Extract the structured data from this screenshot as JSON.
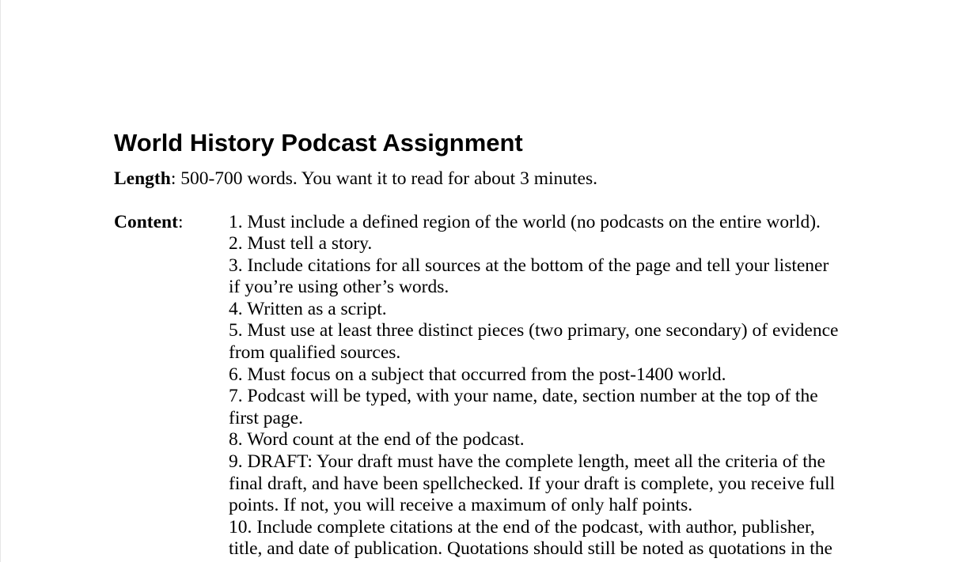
{
  "document": {
    "title": "World History Podcast Assignment",
    "length": {
      "label": "Length",
      "separator": ":",
      "text": " 500-700 words.  You want it to read for about 3 minutes."
    },
    "content": {
      "label": "Content",
      "separator": ":",
      "items": [
        "1. Must include a defined region of the world (no podcasts on the entire world).",
        "2. Must tell a story.",
        "3. Include citations for all sources at the bottom of the page and tell your listener\nif you’re using other’s words.",
        "4. Written as a script.",
        "5. Must use at least three distinct pieces (two primary, one secondary) of evidence\nfrom qualified sources.",
        "6.  Must focus on a subject that occurred from the post-1400 world.",
        "7. Podcast will be typed, with your name, date, section number at the top of the\nfirst page.",
        "8. Word count at the end of the podcast.",
        "9. DRAFT: Your draft must have the complete length, meet all the criteria of the\nfinal draft, and have been spellchecked.  If your draft is complete, you receive full\npoints.  If not, you will receive a maximum of only half points.",
        "10. Include complete citations at the end of the podcast, with author, publisher,\ntitle, and date of publication. Quotations should still be noted as quotations in the"
      ]
    }
  }
}
